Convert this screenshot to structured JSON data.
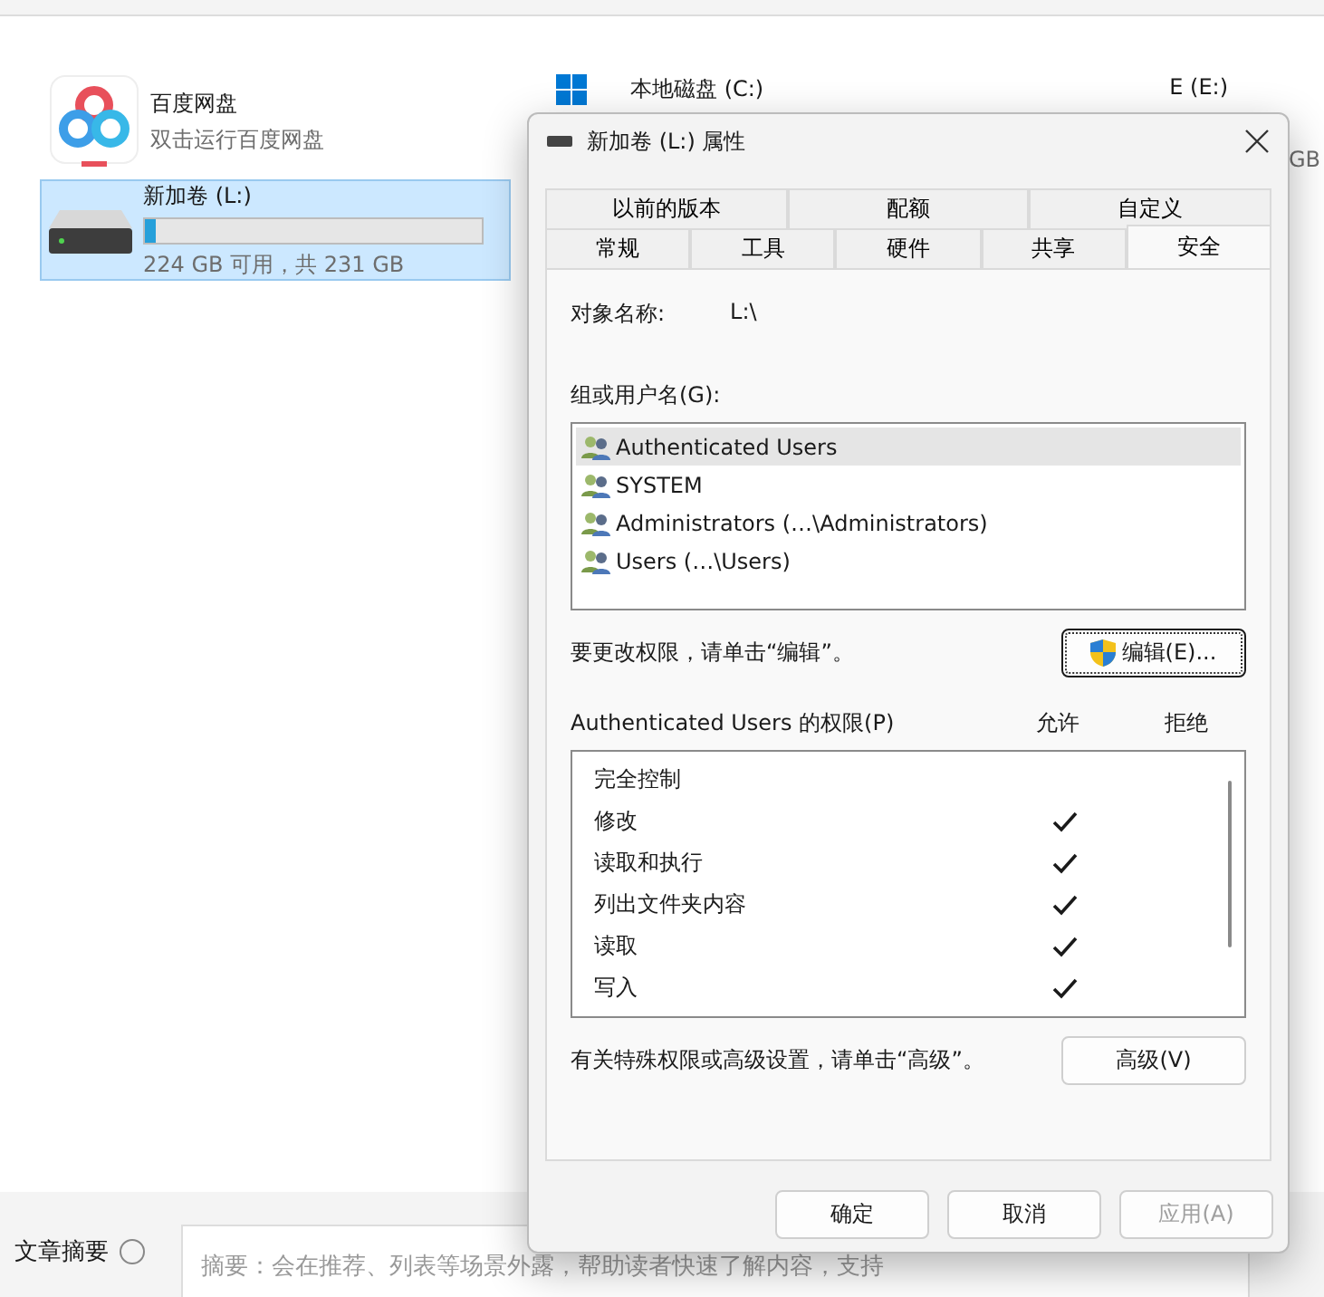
{
  "explorer": {
    "items": [
      {
        "kind": "app",
        "name": "百度网盘",
        "subtitle": "双击运行百度网盘",
        "selected": false
      },
      {
        "kind": "drive",
        "name": "新加卷 (L:)",
        "level": 0.03,
        "subtitle": "224 GB 可用，共 231 GB",
        "selected": true
      }
    ],
    "right_items": [
      {
        "kind": "system",
        "name": "本地磁盘 (C:)"
      },
      {
        "kind": "drive",
        "name": "E (E:)"
      }
    ],
    "edge_text": "GB"
  },
  "editor": {
    "label": "文章摘要",
    "placeholder": "摘要：会在推荐、列表等场景外露，帮助读者快速了解内容，支持"
  },
  "dialog": {
    "title": "新加卷 (L:) 属性",
    "tab_rows": [
      [
        {
          "label": "以前的版本",
          "selected": false
        },
        {
          "label": "配额",
          "selected": false
        },
        {
          "label": "自定义",
          "selected": false
        }
      ],
      [
        {
          "label": "常规",
          "selected": false
        },
        {
          "label": "工具",
          "selected": false
        },
        {
          "label": "硬件",
          "selected": false
        },
        {
          "label": "共享",
          "selected": false
        },
        {
          "label": "安全",
          "selected": true
        }
      ]
    ],
    "object_label": "对象名称:",
    "object_value": "L:\\",
    "users_label": "组或用户名(G):",
    "users": [
      {
        "name": "Authenticated Users",
        "selected": true
      },
      {
        "name": "SYSTEM",
        "selected": false
      },
      {
        "name": "Administrators (…\\Administrators)",
        "selected": false
      },
      {
        "name": "Users (…\\Users)",
        "selected": false
      }
    ],
    "edit_hint": "要更改权限，请单击“编辑”。",
    "edit_button": "编辑(E)...",
    "perm_label": "Authenticated Users 的权限(P)",
    "allow_header": "允许",
    "deny_header": "拒绝",
    "permissions": [
      {
        "name": "完全控制",
        "allow": false,
        "deny": false
      },
      {
        "name": "修改",
        "allow": true,
        "deny": false
      },
      {
        "name": "读取和执行",
        "allow": true,
        "deny": false
      },
      {
        "name": "列出文件夹内容",
        "allow": true,
        "deny": false
      },
      {
        "name": "读取",
        "allow": true,
        "deny": false
      },
      {
        "name": "写入",
        "allow": true,
        "deny": false
      }
    ],
    "advanced_hint": "有关特殊权限或高级设置，请单击“高级”。",
    "advanced_button": "高级(V)",
    "buttons": [
      {
        "label": "确定",
        "disabled": false
      },
      {
        "label": "取消",
        "disabled": false
      },
      {
        "label": "应用(A)",
        "disabled": true
      }
    ]
  }
}
